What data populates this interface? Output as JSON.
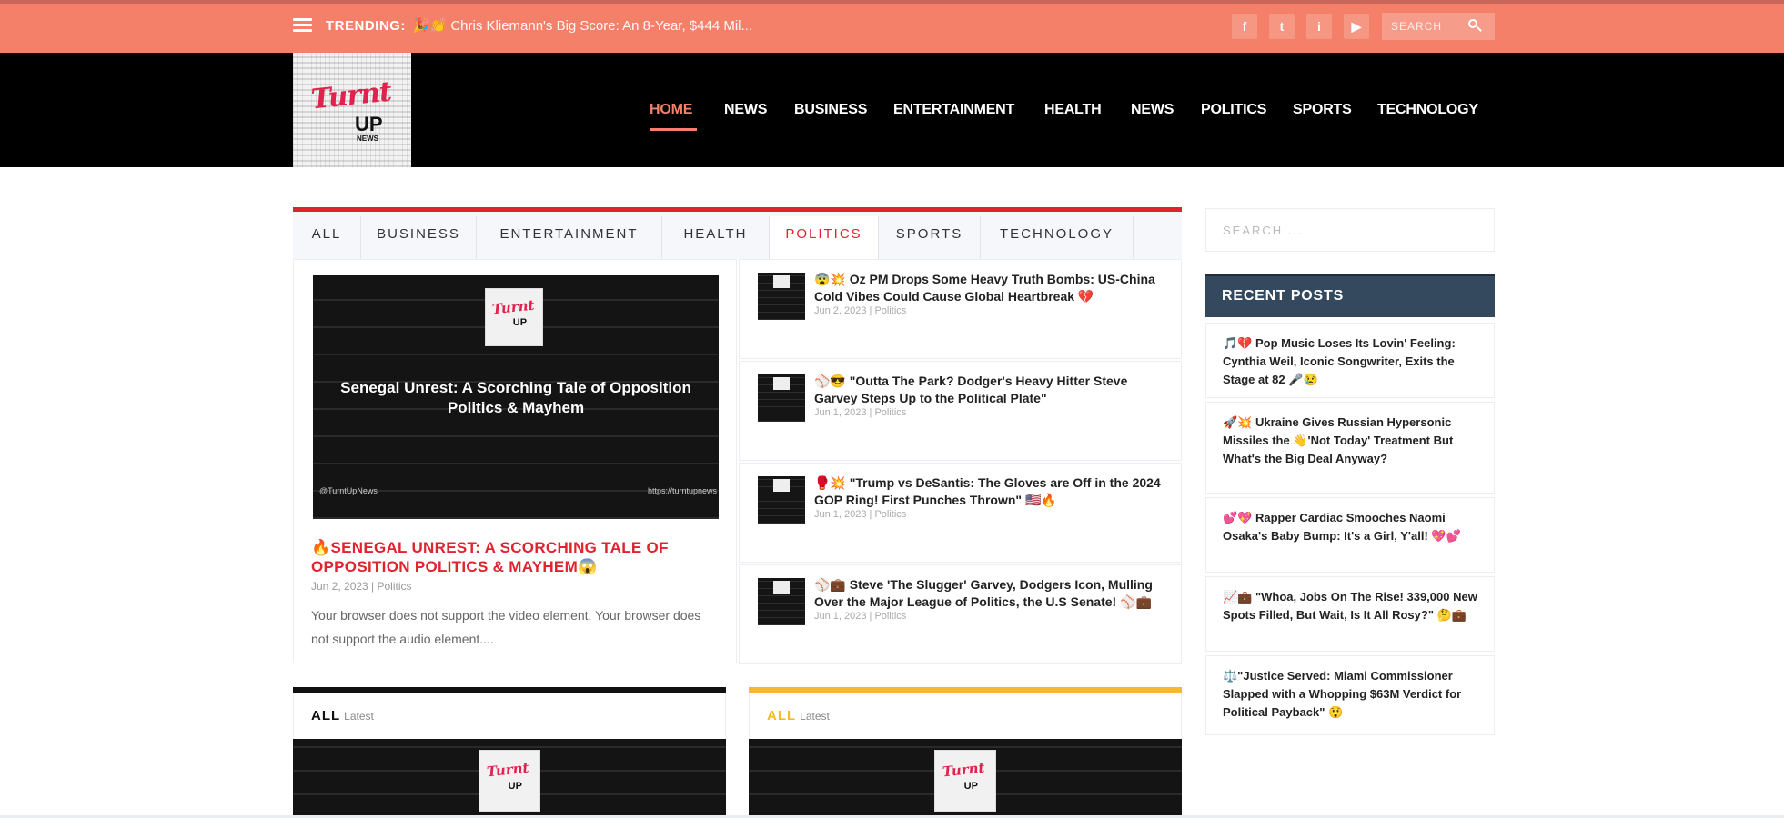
{
  "topbar": {
    "trending_label": "TRENDING:",
    "trending_title": "🎉👏 Chris Kliemann's Big Score: An 8-Year, $444 Mil...",
    "social": [
      "f",
      "t",
      "i",
      "▶"
    ],
    "search_placeholder": "SEARCH"
  },
  "logo": {
    "text": "Turnt",
    "up": "UP",
    "sub": "NEWS"
  },
  "nav": [
    "HOME",
    "NEWS",
    "BUSINESS",
    "ENTERTAINMENT",
    "HEALTH",
    "NEWS",
    "POLITICS",
    "SPORTS",
    "TECHNOLOGY"
  ],
  "tabs": [
    "ALL",
    "BUSINESS",
    "ENTERTAINMENT",
    "HEALTH",
    "POLITICS",
    "SPORTS",
    "TECHNOLOGY"
  ],
  "active_tab": "POLITICS",
  "feature": {
    "image_caption": "Senegal Unrest: A Scorching Tale of Opposition Politics & Mayhem",
    "image_handle": "@TurntUpNews",
    "image_url": "https://turntupnews",
    "title": "🔥SENEGAL UNREST: A SCORCHING TALE OF OPPOSITION POLITICS & MAYHEM😱",
    "meta": "Jun 2, 2023 | Politics",
    "excerpt": "Your browser does not support the video element. Your browser does not support the audio element...."
  },
  "list": [
    {
      "title": "😨💥 Oz PM Drops Some Heavy Truth Bombs: US-China Cold Vibes Could Cause Global Heartbreak 💔",
      "meta": "Jun 2, 2023 | Politics"
    },
    {
      "title": "⚾😎 \"Outta The Park? Dodger's Heavy Hitter Steve Garvey Steps Up to the Political Plate\"",
      "meta": "Jun 1, 2023 | Politics"
    },
    {
      "title": "🥊💥 \"Trump vs DeSantis: The Gloves are Off in the 2024 GOP Ring! First Punches Thrown\" 🇺🇸🔥",
      "meta": "Jun 1, 2023 | Politics"
    },
    {
      "title": "⚾💼 Steve 'The Slugger' Garvey, Dodgers Icon, Mulling Over the Major League of Politics, the U.S Senate! ⚾💼",
      "meta": "Jun 1, 2023 | Politics"
    }
  ],
  "sections": [
    {
      "label": "ALL",
      "sub": "Latest",
      "color": "#111111"
    },
    {
      "label": "ALL",
      "sub": "Latest",
      "color": "#f5b82e"
    }
  ],
  "sidebar": {
    "search_placeholder": "SEARCH ...",
    "recent_title": "RECENT POSTS",
    "posts": [
      "🎵💔 Pop Music Loses Its Lovin' Feeling: Cynthia Weil, Iconic Songwriter, Exits the Stage at 82 🎤😢",
      "🚀💥 Ukraine Gives Russian Hypersonic Missiles the 👋'Not Today' Treatment But What's the Big Deal Anyway?",
      "💕💖 Rapper Cardiac Smooches Naomi Osaka's Baby Bump: It's a Girl, Y'all! 💖💕",
      "📈💼 \"Whoa, Jobs On The Rise! 339,000 New Spots Filled, But Wait, Is It All Rosy?\" 🤔💼",
      "⚖️\"Justice Served: Miami Commissioner Slapped with a Whopping $63M Verdict for Political Payback\" 😲"
    ]
  },
  "colors": {
    "accent": "#f4806a",
    "red": "#e0232f",
    "header": "#000000",
    "sidebar_header": "#34495e"
  }
}
